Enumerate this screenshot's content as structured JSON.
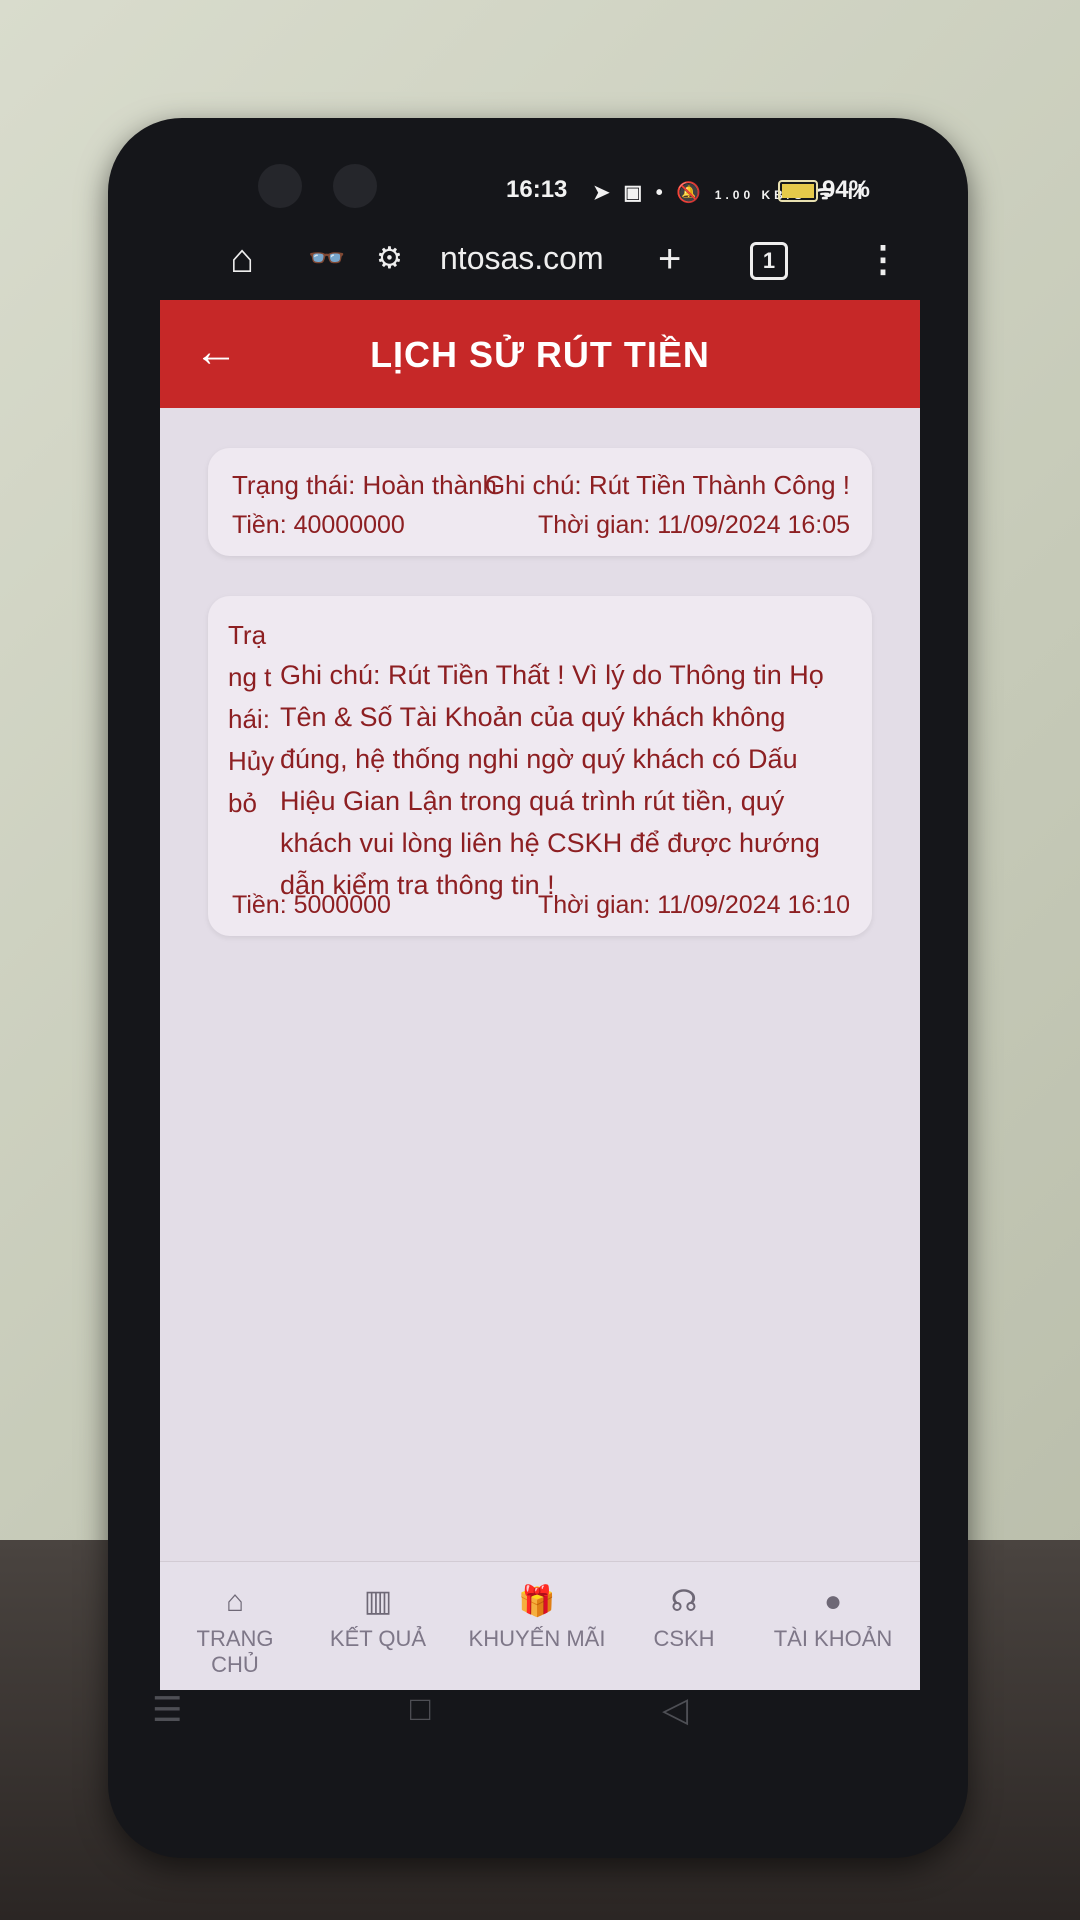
{
  "status_bar": {
    "time": "16:13",
    "net_speed": "1.00 KB/S",
    "battery": "94%"
  },
  "browser": {
    "url": "ntosas.com",
    "tab_count": "1"
  },
  "header": {
    "title": "LỊCH SỬ RÚT TIỀN"
  },
  "records": [
    {
      "status": "Trạng thái: Hoàn thành",
      "note": "Ghi chú: Rút Tiền Thành Công !",
      "amount": "Tiền: 40000000",
      "time": "Thời gian: 11/09/2024 16:05"
    },
    {
      "status": "Trạng thái: Hủy bỏ",
      "note": "Ghi chú: Rút Tiền Thất ! Vì lý do Thông tin Họ Tên & Số Tài Khoản của quý khách không đúng, hệ thống nghi ngờ quý khách có Dấu Hiệu Gian Lận trong quá trình rút tiền, quý khách vui lòng liên hệ CSKH để được hướng dẫn kiểm tra thông tin !",
      "amount": "Tiền: 5000000",
      "time": "Thời gian: 11/09/2024 16:10"
    }
  ],
  "bottom_nav": [
    {
      "label": "TRANG CHỦ",
      "icon": "home-icon"
    },
    {
      "label": "KẾT QUẢ",
      "icon": "chart-icon"
    },
    {
      "label": "KHUYẾN MÃI",
      "icon": "gift-icon"
    },
    {
      "label": "CSKH",
      "icon": "headset-icon"
    },
    {
      "label": "TÀI KHOẢN",
      "icon": "account-icon"
    }
  ],
  "colors": {
    "header_bg": "#c62828",
    "card_text": "#8d1f22",
    "screen_bg": "#e3dde7"
  }
}
